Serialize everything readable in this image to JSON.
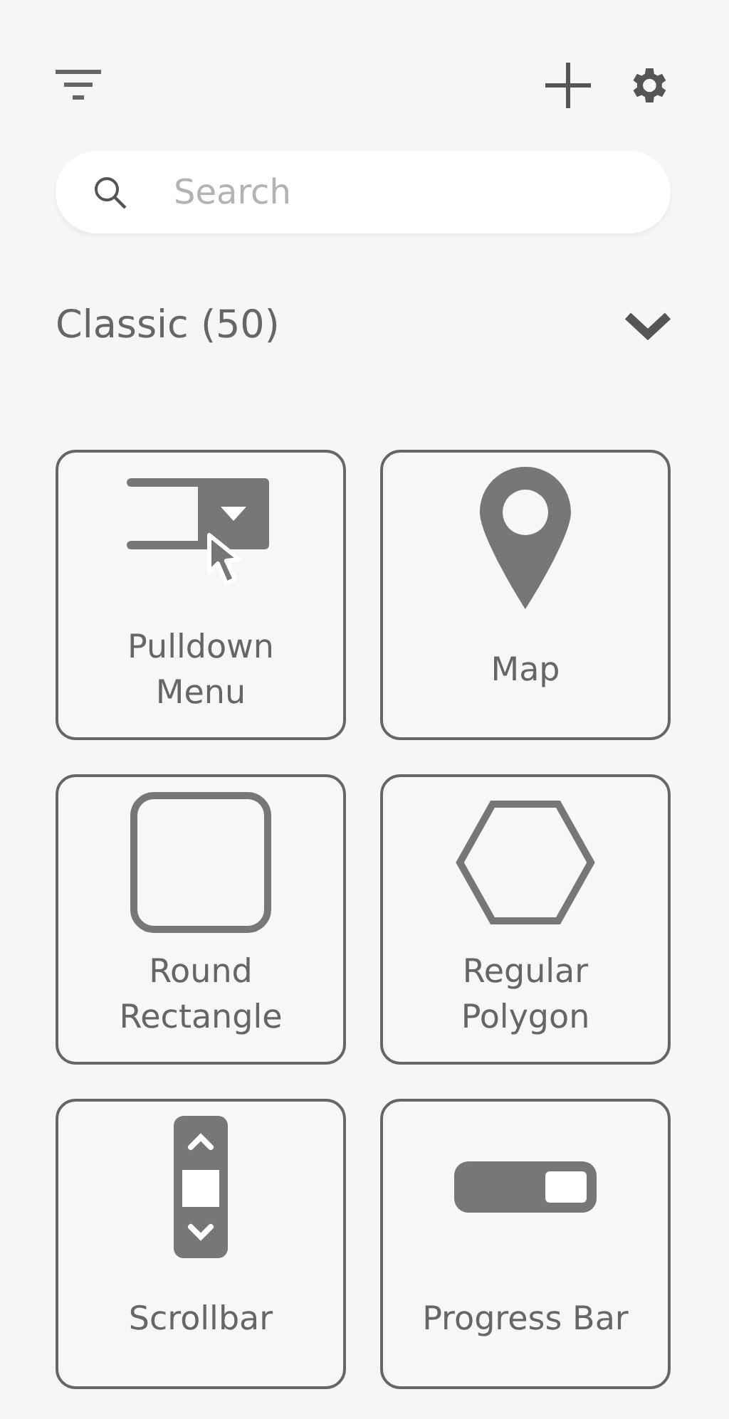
{
  "search": {
    "placeholder": "Search"
  },
  "section": {
    "title": "Classic (50)",
    "expanded": true
  },
  "items": [
    {
      "kind": "pulldown",
      "label": "Pulldown\nMenu"
    },
    {
      "kind": "map",
      "label": "Map"
    },
    {
      "kind": "roundrect",
      "label": "Round\nRectangle"
    },
    {
      "kind": "polygon",
      "label": "Regular\nPolygon"
    },
    {
      "kind": "scrollbar",
      "label": "Scrollbar"
    },
    {
      "kind": "progress",
      "label": "Progress Bar"
    }
  ]
}
